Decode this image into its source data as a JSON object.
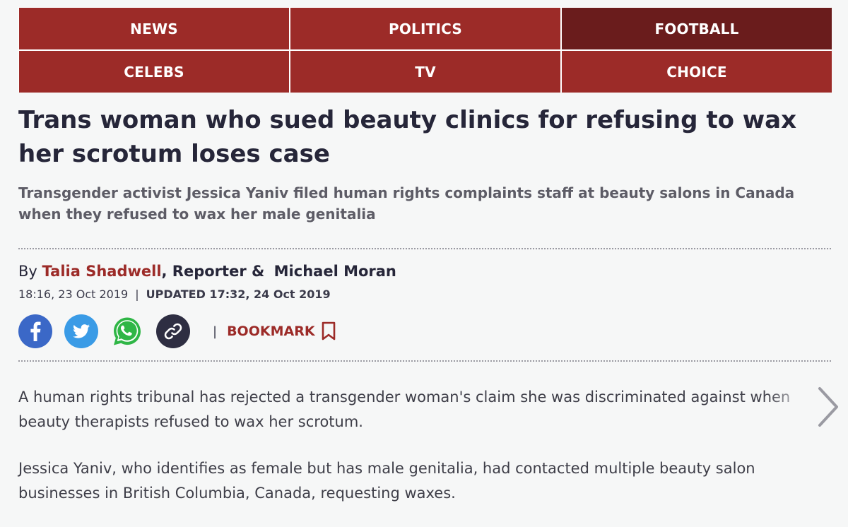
{
  "nav": {
    "items": [
      {
        "label": "NEWS"
      },
      {
        "label": "POLITICS"
      },
      {
        "label": "FOOTBALL"
      },
      {
        "label": "CELEBS"
      },
      {
        "label": "TV"
      },
      {
        "label": "CHOICE"
      }
    ],
    "active": "FOOTBALL"
  },
  "article": {
    "headline": "Trans woman who sued beauty clinics for refusing to wax her scrotum loses case",
    "standfirst": "Transgender activist Jessica Yaniv filed human rights complaints staff at beauty salons in Canada when they refused to wax her male genitalia",
    "byline": {
      "prefix": "By",
      "author1": "Talia Shadwell",
      "role": ", Reporter &",
      "author2": "Michael Moran"
    },
    "published": "18:16, 23 Oct 2019",
    "separator": "|",
    "updated": "UPDATED 17:32, 24 Oct 2019",
    "paragraphs": [
      "A human rights tribunal has rejected a transgender woman's claim she was discriminated against when beauty therapists refused to wax her scrotum.",
      "Jessica Yaniv, who identifies as female but has male genitalia, had contacted multiple beauty salon businesses in British Columbia, Canada, requesting waxes."
    ]
  },
  "share": {
    "icons": [
      "facebook-icon",
      "twitter-icon",
      "whatsapp-icon",
      "link-icon"
    ],
    "divider": "|",
    "bookmark_label": "BOOKMARK"
  },
  "colors": {
    "brand": "#9c2b28",
    "nav_active": "#6a1c1c",
    "facebook": "#3b68c7",
    "twitter": "#3a9be6",
    "whatsapp": "#2fb646",
    "link": "#2e2e42"
  }
}
